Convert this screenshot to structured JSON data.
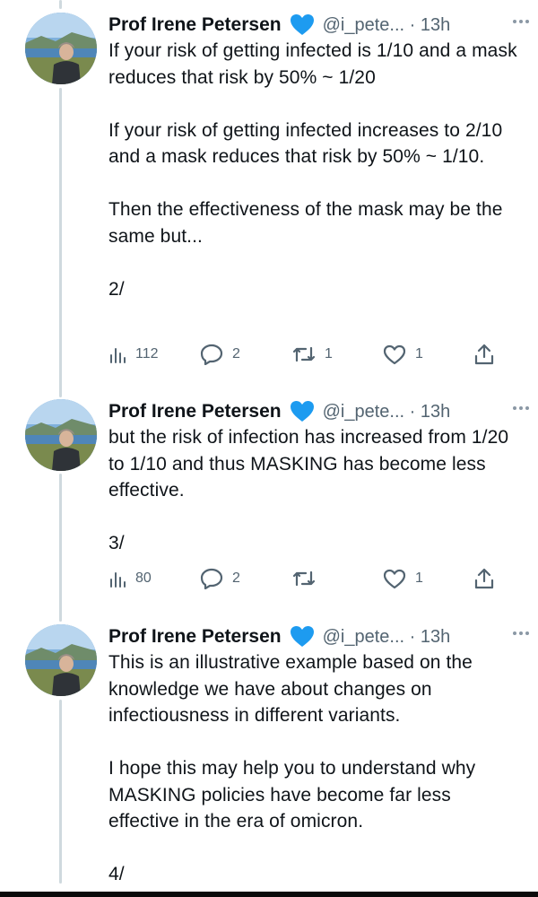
{
  "tweets": [
    {
      "name": "Prof Irene Petersen",
      "handle": "@i_pete... · 13h",
      "text": "If your risk of getting infected is 1/10 and a mask reduces that risk by 50% ~ 1/20\n\nIf your risk of getting infected increases to 2/10 and a mask reduces that risk by 50% ~ 1/10.\n\nThen the effectiveness of the mask may be the same but...\n\n2/",
      "views": "112",
      "replies": "2",
      "retweets": "1",
      "likes": "1"
    },
    {
      "name": "Prof Irene Petersen",
      "handle": "@i_pete... · 13h",
      "text": "but the risk of infection has increased from 1/20 to 1/10 and thus MASKING has become less effective.\n\n3/",
      "views": "80",
      "replies": "2",
      "retweets": "",
      "likes": "1"
    },
    {
      "name": "Prof Irene Petersen",
      "handle": "@i_pete... · 13h",
      "text": "This is an illustrative example based on the knowledge we have about changes on infectiousness in different variants.\n\nI hope this may help you to understand why MASKING policies have become far less effective in the era of omicron.\n\n4/",
      "views": "",
      "replies": "",
      "retweets": "",
      "likes": ""
    }
  ],
  "colors": {
    "verified": "#1d9bf0",
    "secondary": "#536471",
    "thread_line": "#cfd9de"
  },
  "icons": [
    "views-icon",
    "reply-icon",
    "retweet-icon",
    "like-icon",
    "share-icon",
    "verified-heart-icon",
    "more-icon"
  ]
}
